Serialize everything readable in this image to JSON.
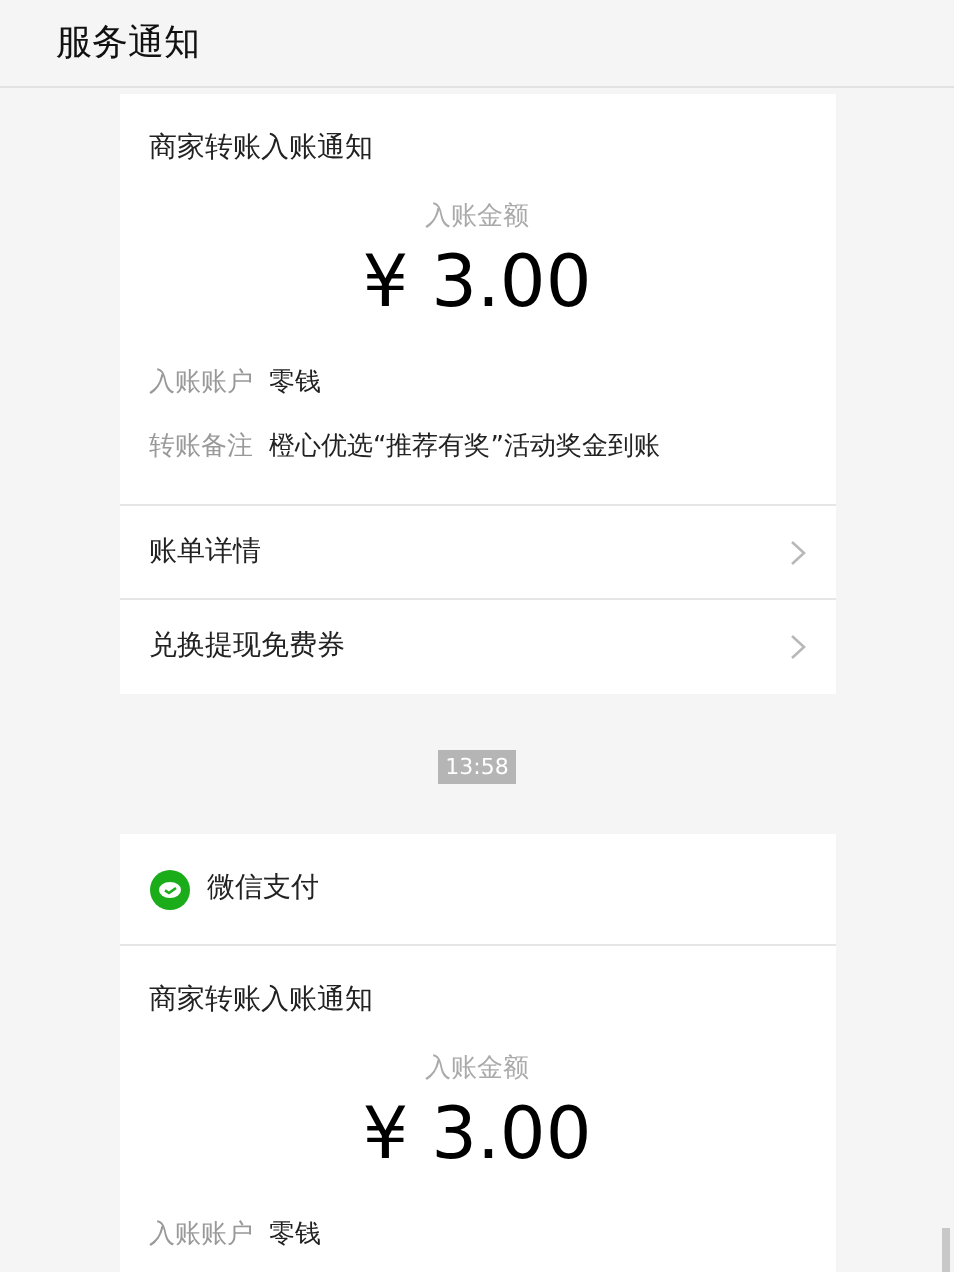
{
  "header": {
    "title": "服务通知"
  },
  "feed": [
    {
      "kind": "card",
      "title": "商家转账入账通知",
      "amount_label": "入账金额",
      "amount": "¥ 3.00",
      "fields": [
        {
          "label": "入账账户",
          "value": "零钱"
        },
        {
          "label": "转账备注",
          "value": "橙心优选“推荐有奖”活动奖金到账"
        }
      ],
      "links": [
        "账单详情",
        "兑换提现免费券"
      ]
    },
    {
      "kind": "time",
      "text": "13:58"
    },
    {
      "kind": "card",
      "source": "微信支付",
      "title": "商家转账入账通知",
      "amount_label": "入账金额",
      "amount": "¥ 3.00",
      "fields": [
        {
          "label": "入账账户",
          "value": "零钱"
        }
      ]
    }
  ]
}
